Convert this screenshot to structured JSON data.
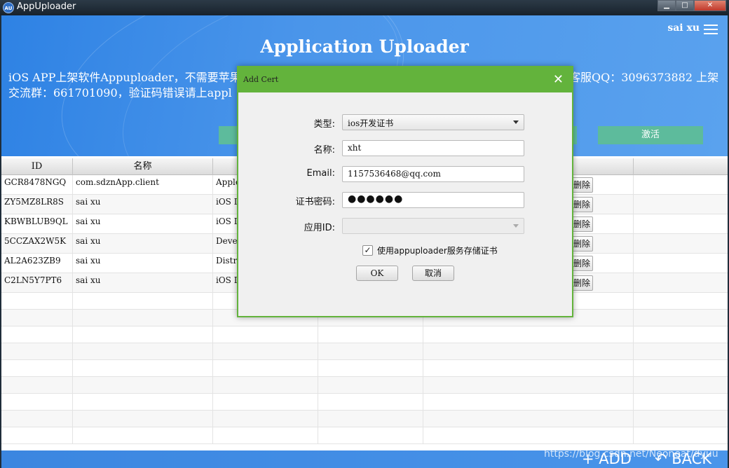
{
  "window": {
    "title": "AppUploader",
    "icon_text": "AU",
    "minimize": "▁",
    "maximize": "□",
    "close": "✕"
  },
  "header": {
    "title": "Application Uploader",
    "user": "sai xu",
    "notice_line1": "iOS APP上架软件Appuploader，不需要苹果",
    "notice_line1_right": "客服QQ：3096373882 上架",
    "notice_line2": "交流群：661701090，验证码错误请上appl",
    "activate_label": "激活"
  },
  "table": {
    "columns": [
      "ID",
      "名称"
    ],
    "rows": [
      {
        "id": "GCR8478NGQ",
        "name": "com.sdznApp.client",
        "type": "Apple",
        "action": "删除"
      },
      {
        "id": "ZY5MZ8LR8S",
        "name": "sai xu",
        "type": "iOS D",
        "action": "删除"
      },
      {
        "id": "KBWBLUB9QL",
        "name": "sai xu",
        "type": "iOS D",
        "action": "删除"
      },
      {
        "id": "5CCZAX2W5K",
        "name": "sai xu",
        "type": "Develo",
        "action": "删除"
      },
      {
        "id": "AL2A623ZB9",
        "name": "sai xu",
        "type": "Distrib",
        "action": "删除"
      },
      {
        "id": "C2LN5Y7PT6",
        "name": "sai xu",
        "type": "iOS D",
        "action": "删除"
      }
    ]
  },
  "footer": {
    "add": "+ ADD",
    "back": "↶ BACK",
    "watermark": "https://blog.csdn.net/Neoneat/dyuu"
  },
  "dialog": {
    "title": "Add Cert",
    "close": "✕",
    "type_label": "类型:",
    "type_value": "ios开发证书",
    "name_label": "名称:",
    "name_value": "xht",
    "email_label": "Email:",
    "email_value": "1157536468@qq.com",
    "password_label": "证书密码:",
    "password_value": "●●●●●●",
    "appid_label": "应用ID:",
    "appid_value": "",
    "store_checked": true,
    "store_check_mark": "✓",
    "store_label": "使用appuploader服务存储证书",
    "ok": "OK",
    "cancel": "取消"
  }
}
